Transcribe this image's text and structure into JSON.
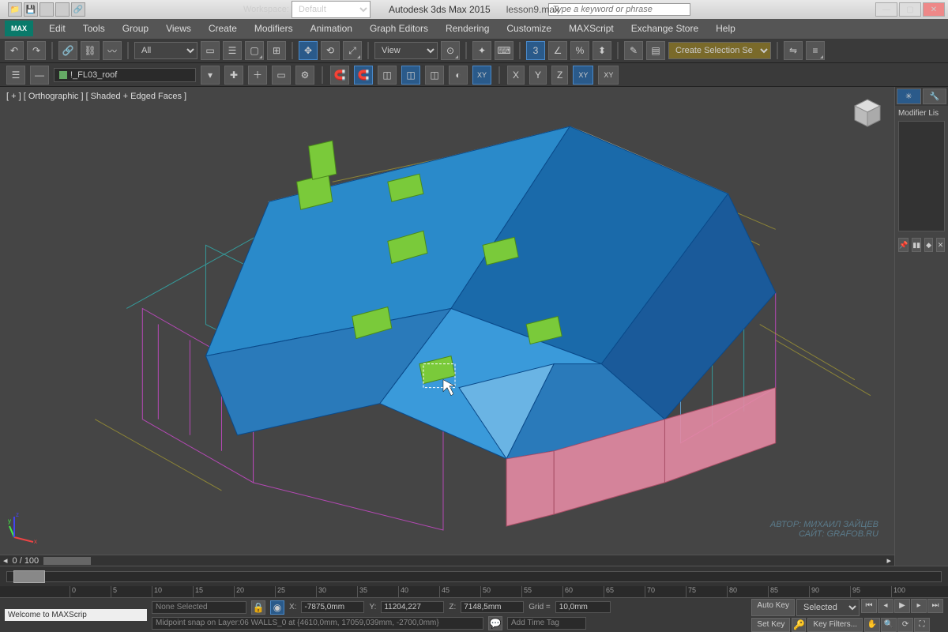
{
  "title": {
    "app": "Autodesk 3ds Max  2015",
    "file": "lesson9.max"
  },
  "workspace": {
    "label": "Workspace:",
    "value": "Default"
  },
  "search": {
    "placeholder": "Type a keyword or phrase"
  },
  "menu": [
    "Edit",
    "Tools",
    "Group",
    "Views",
    "Create",
    "Modifiers",
    "Animation",
    "Graph Editors",
    "Rendering",
    "Customize",
    "MAXScript",
    "Exchange Store",
    "Help"
  ],
  "toolbar1": {
    "sel_filter": "All",
    "view_dd": "View",
    "angle_snap": "3",
    "sel_set": "Create Selection Se"
  },
  "layer": {
    "name": "!_FL03_roof"
  },
  "axes": {
    "x": "X",
    "y": "Y",
    "z": "Z",
    "xy": "XY",
    "xyz": "XY"
  },
  "viewport": {
    "label": "[ + ] [ Orthographic ] [ Shaded + Edged Faces ]",
    "frame_pos": "0 / 100"
  },
  "sidepanel": {
    "header": "Modifier Lis"
  },
  "ruler": [
    "0",
    "5",
    "10",
    "15",
    "20",
    "25",
    "30",
    "35",
    "40",
    "45",
    "50",
    "55",
    "60",
    "65",
    "70",
    "75",
    "80",
    "85",
    "90",
    "95",
    "100"
  ],
  "status": {
    "welcome": "Welcome to MAXScrip",
    "selection": "None Selected",
    "hint": "Midpoint snap on Layer:06 WALLS_0 at {4610,0mm, 17059,039mm, -2700,0mm}",
    "x": "-7875,0mm",
    "y": "11204,227",
    "z": "7148,5mm",
    "grid_label": "Grid =",
    "grid": "10,0mm",
    "time_tag": "Add Time Tag",
    "auto_key": "Auto Key",
    "set_key": "Set Key",
    "sel_mode": "Selected",
    "key_filters": "Key Filters..."
  },
  "watermark": {
    "author": "АВТОР: МИХАИЛ ЗАЙЦЕВ",
    "site": "САЙТ: GRAFOB.RU"
  }
}
